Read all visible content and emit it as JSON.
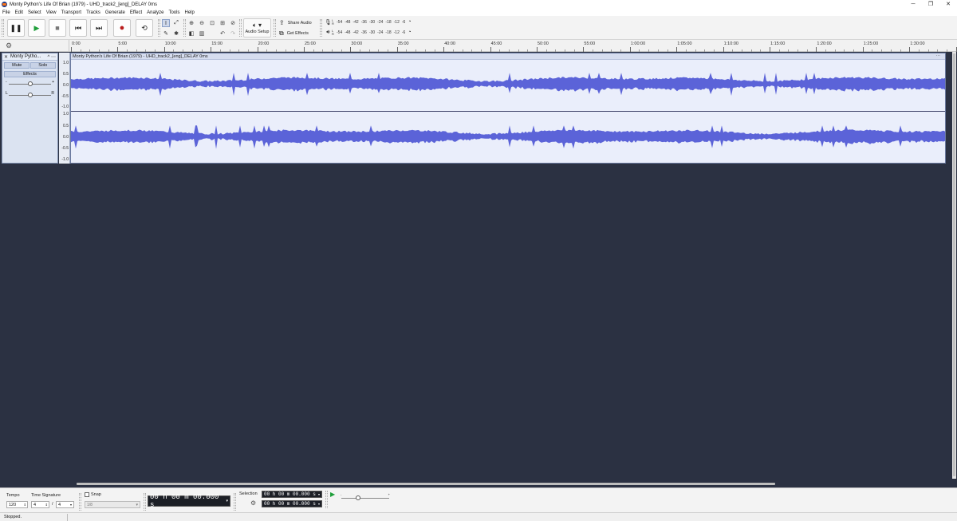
{
  "window": {
    "title": "Monty Python's Life Of Brian (1979) - UHD_track2_[eng]_DELAY 0ms",
    "minimize": "─",
    "maximize": "❐",
    "close": "✕"
  },
  "menu": [
    "File",
    "Edit",
    "Select",
    "View",
    "Transport",
    "Tracks",
    "Generate",
    "Effect",
    "Analyze",
    "Tools",
    "Help"
  ],
  "transport": {
    "pause": "❚❚",
    "play": "▶",
    "stop": "■",
    "skip_start": "⏮",
    "skip_end": "⏭",
    "record": "●",
    "loop": "⟲"
  },
  "toolbar": {
    "audio_setup_label": "Audio Setup",
    "share_audio_label": "Share Audio",
    "get_effects_label": "Get Effects",
    "meter_ticks": [
      "-54",
      "-48",
      "-42",
      "-36",
      "-30",
      "-24",
      "-18",
      "-12",
      "-6"
    ],
    "record_meter_channels": "L R",
    "play_meter_channels": "L R"
  },
  "ruler": {
    "labels": [
      "0:00",
      "5:00",
      "10:00",
      "15:00",
      "20:00",
      "25:00",
      "30:00",
      "35:00",
      "40:00",
      "45:00",
      "50:00",
      "55:00",
      "1:00:00",
      "1:05:00",
      "1:10:00",
      "1:15:00",
      "1:20:00",
      "1:25:00",
      "1:30:00",
      "1:35:00"
    ]
  },
  "track": {
    "name": "Monty Pytho...",
    "mute_label": "Mute",
    "solo_label": "Solo",
    "effects_label": "Effects",
    "gain_minus": "-",
    "gain_plus": "+",
    "pan_left": "L",
    "pan_right": "R",
    "clip_title": "Monty Python's Life Of Brian (1979) - UHD_track2_[eng]_DELAY 0ms",
    "scale_labels": [
      "1.0",
      "0.5",
      "0.0",
      "-0.5",
      "-1.0"
    ],
    "color": "#5b63d8"
  },
  "bottom": {
    "tempo_label": "Tempo",
    "tempo_value": "120",
    "time_signature_label": "Time Signature",
    "ts_numerator": "4",
    "ts_slash": "/",
    "ts_denominator": "4",
    "snap_label": "Snap",
    "snap_value": "1/8",
    "time_display": "00 h 00 m 00.000 s",
    "selection_label": "Selection",
    "selection_start": "00 h 00 m 00.000 s",
    "selection_end": "00 h 00 m 00.000 s"
  },
  "status": {
    "text": "Stopped."
  }
}
